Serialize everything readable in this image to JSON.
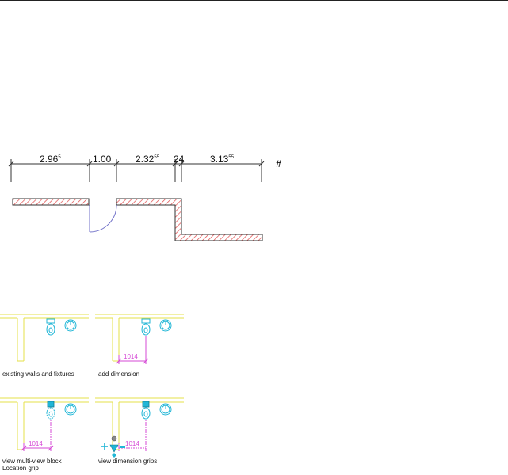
{
  "top_plan": {
    "dimensions": [
      {
        "main": "2.96",
        "sup": "5"
      },
      {
        "main": "1.00",
        "sup": ""
      },
      {
        "main": "2.32",
        "sup": "55"
      },
      {
        "main": "24",
        "sup": ""
      },
      {
        "main": "3.13",
        "sup": "55"
      }
    ],
    "marker": "#"
  },
  "panels": [
    {
      "caption_line1": "existing walls and fixtures",
      "caption_line2": "",
      "dimension": ""
    },
    {
      "caption_line1": "add dimension",
      "caption_line2": "",
      "dimension": "1014"
    },
    {
      "caption_line1": "view multi-view block",
      "caption_line2": "Location grip",
      "dimension": "1014"
    },
    {
      "caption_line1": "view dimension grips",
      "caption_line2": "",
      "dimension": "1014"
    }
  ],
  "colors": {
    "wall_hatch": "#e04a4a",
    "wall_outline": "#333333",
    "door_arc": "#7070c8",
    "fixture": "#21b6d6",
    "wall_thin": "#e6e04a",
    "dimension_small": "#d64ad6",
    "grip": "#21b6d6"
  }
}
